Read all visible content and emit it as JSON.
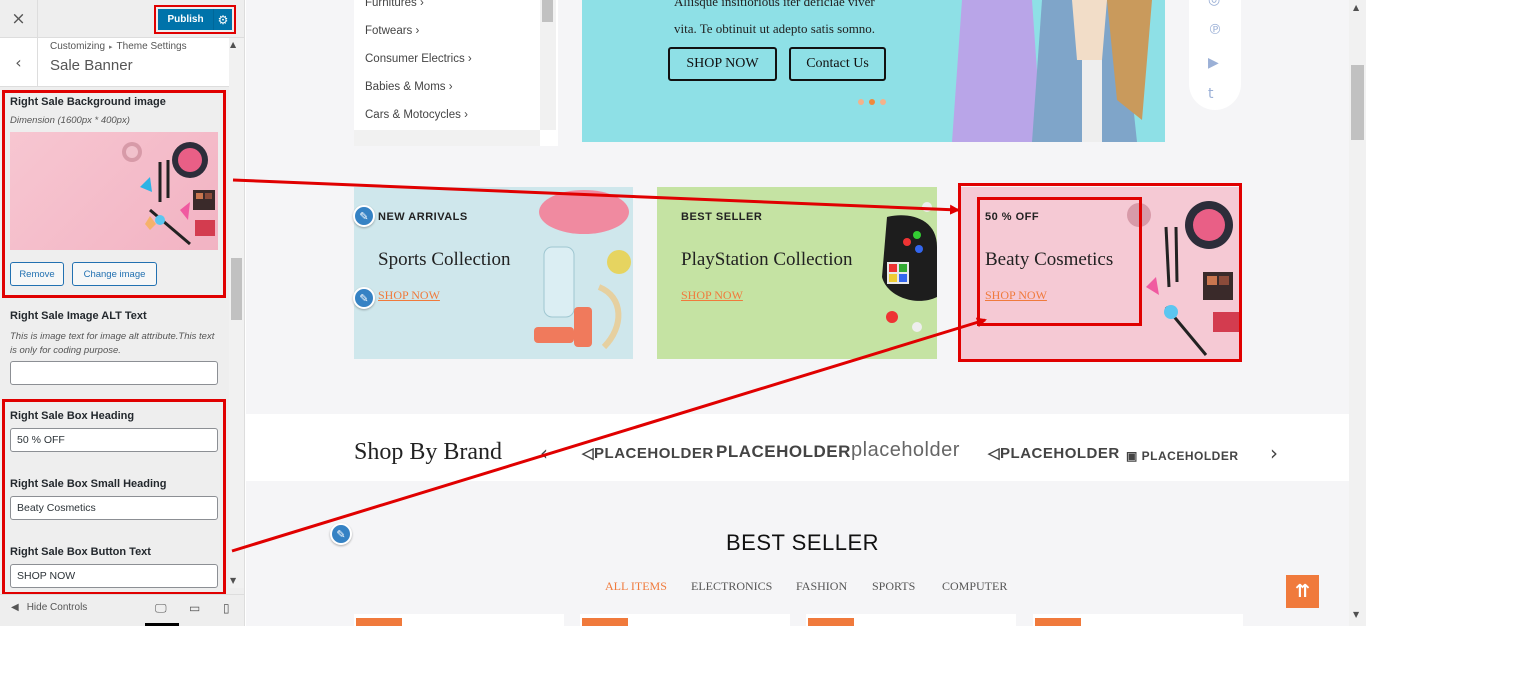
{
  "sidebar": {
    "close_icon": "×",
    "publish_label": "Publish",
    "gear_icon": "⚙",
    "back_icon": "‹",
    "breadcrumb": [
      "Customizing",
      "Theme Settings"
    ],
    "breadcrumb_sep": "▸",
    "section_title": "Sale Banner",
    "controls": {
      "bg_image_label": "Right Sale Background image",
      "bg_image_desc": "Dimension (1600px * 400px)",
      "remove_label": "Remove",
      "change_image_label": "Change image",
      "alt_label": "Right Sale Image ALT Text",
      "alt_desc": "This is image text for image alt attribute.This text is only for coding purpose.",
      "alt_value": "",
      "heading_label": "Right Sale Box Heading",
      "heading_value": "50 % OFF",
      "small_heading_label": "Right Sale Box Small Heading",
      "small_heading_value": "Beaty Cosmetics",
      "button_text_label": "Right Sale Box Button Text",
      "button_text_value": "SHOP NOW"
    },
    "footer": {
      "hide_controls_label": "Hide Controls",
      "hide_icon": "◀",
      "desktop_icon": "🖵",
      "tablet_icon": "▭",
      "mobile_icon": "▯"
    }
  },
  "preview": {
    "categories": [
      "Furnitures",
      "Fotwears",
      "Consumer Electrics",
      "Babies & Moms",
      "Cars & Motocycles"
    ],
    "cat_chevron": "›",
    "hero": {
      "text_line1": "Aliisque insitiorious iter deficiae viver",
      "text_line2": "vita. Te obtinuit ut adepto satis somno.",
      "button1": "SHOP NOW",
      "button2": "Contact Us"
    },
    "social_icons": [
      "instagram-icon",
      "pinterest-icon",
      "youtube-icon",
      "tumblr-icon"
    ],
    "social_glyphs": [
      "◎",
      "℗",
      "▶",
      "t"
    ],
    "banners": [
      {
        "tag": "NEW ARRIVALS",
        "title": "Sports Collection",
        "link": "SHOP NOW",
        "bg": "#cfe7ec"
      },
      {
        "tag": "BEST SELLER",
        "title": "PlayStation Collection",
        "link": "SHOP NOW",
        "bg": "#c5e3a3"
      },
      {
        "tag": "50 % OFF",
        "title": "Beaty Cosmetics",
        "link": "SHOP NOW",
        "bg": "#f5c9d4"
      }
    ],
    "brand": {
      "title": "Shop By Brand",
      "prev_icon": "‹",
      "next_icon": "›",
      "logos": [
        "PLACEHOLDER",
        "PLACEHOLDER",
        "placeholder",
        "PLACEHOLDER",
        "PLACEHOLDER"
      ]
    },
    "best_seller": {
      "title": "BEST SELLER",
      "tabs": [
        "ALL ITEMS",
        "ELECTRONICS",
        "FASHION",
        "SPORTS",
        "COMPUTER"
      ]
    },
    "to_top_icon": "⇈",
    "edit_icon": "✎"
  },
  "colors": {
    "accent": "#f07a3c",
    "wp_blue": "#0073aa",
    "annotation_red": "#e00000"
  }
}
